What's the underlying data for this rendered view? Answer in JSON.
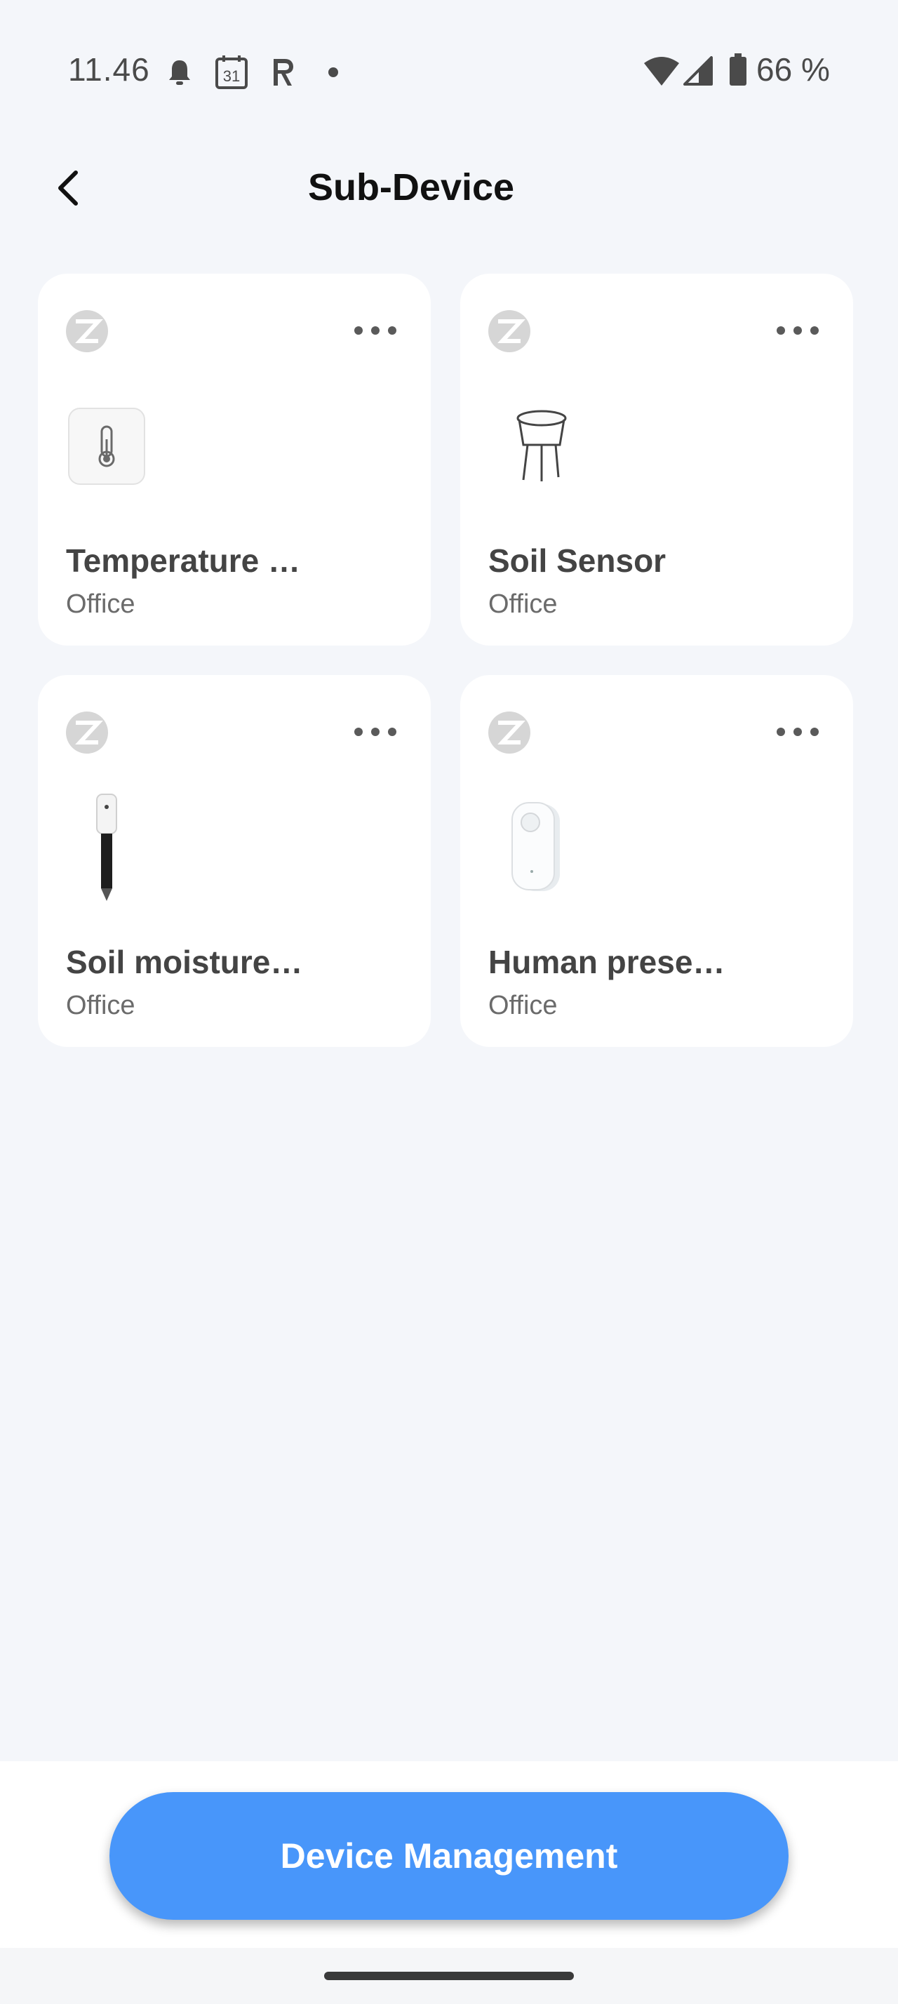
{
  "status_bar": {
    "time": "11.46",
    "calendar_day": "31",
    "battery_text": "66 %",
    "icons": [
      "bell-icon",
      "calendar-icon",
      "r-app-icon",
      "dot-icon",
      "wifi-icon",
      "cell-signal-icon",
      "battery-icon"
    ]
  },
  "header": {
    "title": "Sub-Device",
    "back_icon": "chevron-left-icon"
  },
  "devices": [
    {
      "name": "Temperature …",
      "room": "Office",
      "image": "thermometer-sensor-icon",
      "protocol_icon": "zigbee-icon",
      "menu_icon": "more-dots-icon"
    },
    {
      "name": "Soil Sensor",
      "room": "Office",
      "image": "soil-sensor-icon",
      "protocol_icon": "zigbee-icon",
      "menu_icon": "more-dots-icon"
    },
    {
      "name": "Soil moisture…",
      "room": "Office",
      "image": "soil-moisture-probe-icon",
      "protocol_icon": "zigbee-icon",
      "menu_icon": "more-dots-icon"
    },
    {
      "name": "Human prese…",
      "room": "Office",
      "image": "presence-sensor-icon",
      "protocol_icon": "zigbee-icon",
      "menu_icon": "more-dots-icon"
    }
  ],
  "footer": {
    "button_label": "Device Management"
  },
  "colors": {
    "background": "#f4f6fa",
    "card": "#ffffff",
    "accent": "#4896fa",
    "title_text": "#111111",
    "secondary_text": "#6b6b6b"
  }
}
